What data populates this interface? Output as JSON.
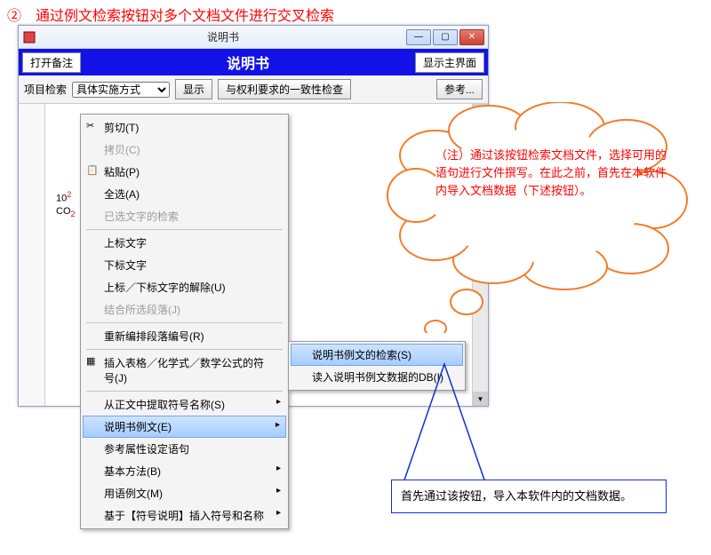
{
  "heading": "②　通过例文检索按钮对多个文档文件进行交叉检索",
  "window": {
    "title": "说明书",
    "btn_open": "打开备注",
    "btn_main": "显示主界面",
    "toolbar": {
      "label": "项目检索",
      "select_value": "具体实施方式",
      "show": "显示",
      "consistency": "与权利要求的一致性检查",
      "ref": "参考..."
    },
    "big_title": "说明书",
    "win_min": "—",
    "win_max": "▢",
    "win_close": "✕",
    "scrollup": "▲",
    "scrolldn": "▼",
    "sample_ten": "10",
    "sample_co": "CO",
    "sample_sup": "2",
    "sample_sub": "2"
  },
  "menu": {
    "items": [
      {
        "label": "剪切(T)",
        "dis": false,
        "sep": false,
        "icon": "cut"
      },
      {
        "label": "拷贝(C)",
        "dis": true,
        "sep": false,
        "icon": ""
      },
      {
        "label": "粘贴(P)",
        "dis": false,
        "sep": false,
        "icon": "paste"
      },
      {
        "label": "全选(A)",
        "dis": false,
        "sep": false,
        "icon": ""
      },
      {
        "label": "已选文字的检索",
        "dis": true,
        "sep": true,
        "icon": ""
      },
      {
        "label": "上标文字",
        "dis": false,
        "sep": false,
        "icon": ""
      },
      {
        "label": "下标文字",
        "dis": false,
        "sep": false,
        "icon": ""
      },
      {
        "label": "上标／下标文字的解除(U)",
        "dis": false,
        "sep": false,
        "icon": ""
      },
      {
        "label": "结合所选段落(J)",
        "dis": true,
        "sep": true,
        "icon": ""
      },
      {
        "label": "重新编排段落编号(R)",
        "dis": false,
        "sep": true,
        "icon": ""
      },
      {
        "label": "插入表格／化学式／数学公式的符号(J)",
        "dis": false,
        "sep": true,
        "icon": "grid"
      },
      {
        "label": "从正文中提取符号名称(S)",
        "dis": false,
        "sep": false,
        "icon": "",
        "arrow": true
      },
      {
        "label": "说明书例文(E)",
        "dis": false,
        "sep": false,
        "icon": "",
        "arrow": true,
        "active": true
      },
      {
        "label": "参考属性设定语句",
        "dis": false,
        "sep": false,
        "icon": ""
      },
      {
        "label": "基本方法(B)",
        "dis": false,
        "sep": false,
        "icon": "",
        "arrow": true
      },
      {
        "label": "用语例文(M)",
        "dis": false,
        "sep": false,
        "icon": "",
        "arrow": true
      },
      {
        "label": "基于【符号说明】插入符号和名称",
        "dis": false,
        "sep": false,
        "icon": "",
        "arrow": true
      }
    ]
  },
  "submenu": {
    "items": [
      {
        "label": "说明书例文的检索(S)",
        "active": true
      },
      {
        "label": "读入说明书例文数据的DB(I)",
        "active": false
      }
    ]
  },
  "cloud_text": "（注）通过该按钮检索文档文件，选择可用的语句进行文件撰写。在此之前，首先在本软件内导入文档数据（下述按钮）。",
  "bluebox_text": "首先通过该按钮，导入本软件内的文档数据。"
}
